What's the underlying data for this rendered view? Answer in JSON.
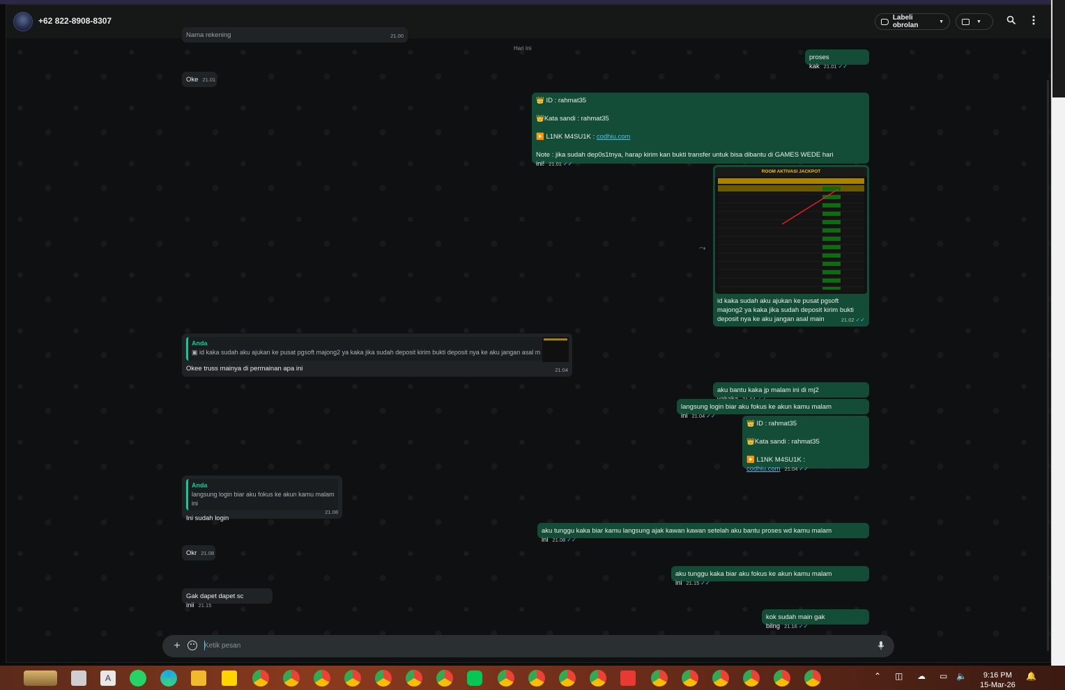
{
  "header": {
    "contact_name": "+62 822-8908-8307",
    "label_button": "Labeli obrolan",
    "video_icon": "video-call-icon",
    "search_icon": "search-icon",
    "menu_icon": "more-vert-icon"
  },
  "chat": {
    "clipped_top_text": "Nama rekening",
    "clipped_top_time": "21.00",
    "day_chip": "Hari Ini",
    "messages": {
      "m1": {
        "text": "proses kak",
        "time": "21.01"
      },
      "m2": {
        "text": "Oke",
        "time": "21.01"
      },
      "m3": {
        "line1": "👑 ID :  rahmat35",
        "line2": "👑Kata sandi : rahmat35",
        "line3_prefix": "▶️ L1NK M4SU1K : ",
        "line3_link": "codhiu.com",
        "line4": "Note : jika sudah dep0s1tnya, harap kirim kan bukti transfer untuk bisa dibantu di GAMES WEDE hari ini!",
        "time": "21.01"
      },
      "m4": {
        "image_title": "ROOM AKTIVASI JACKPOT",
        "caption": "id kaka sudah aku ajukan ke pusat pgsoft majong2 ya kaka jika sudah deposit kirim bukti deposit nya ke aku jangan asal main",
        "time": "21.02"
      },
      "m5": {
        "quote_name": "Anda",
        "quote_text": "id kaka sudah aku ajukan ke pusat pgsoft majong2 ya kaka jika sudah deposit kirim bukti deposit nya ke aku jangan asal main",
        "text": "Okee truss mainya di permainan apa ini",
        "time": "21.04"
      },
      "m6": {
        "text": "aku bantu kaka jp malam ini di mj2 yakaka",
        "time": "21.04"
      },
      "m7": {
        "text": "langsung login biar aku fokus ke akun kamu malam ini",
        "time": "21.04"
      },
      "m8": {
        "line1": "👑 ID :  rahmat35",
        "line2": "👑Kata sandi : rahmat35",
        "line3_prefix": "▶️ L1NK M4SU1K : ",
        "line3_link": "codhiu.com",
        "time": "21.04"
      },
      "m9": {
        "quote_name": "Anda",
        "quote_text": "langsung login biar aku fokus ke akun kamu malam ini",
        "text": "Ini sudah login",
        "time": "21.08"
      },
      "m10": {
        "text": "aku tunggu kaka biar kamu langsung ajak kawan kawan setelah aku bantu proses wd kamu malam ini",
        "time": "21.08"
      },
      "m11": {
        "text": "Okr",
        "time": "21.08"
      },
      "m12": {
        "text": "aku tunggu kaka biar aku fokus ke akun kamu malam ini",
        "time": "21.15"
      },
      "m13": {
        "text": "Gak dapet dapet sc inii",
        "time": "21.15"
      },
      "m14": {
        "text": "kok sudah main gak bilng",
        "time": "21.16"
      }
    }
  },
  "composer": {
    "placeholder": "Ketik pesan",
    "attach_icon": "plus-icon",
    "emoji_icon": "sticker-icon",
    "mic_icon": "mic-icon"
  },
  "taskbar": {
    "time": "9:16 PM",
    "date": "15-Mar-26"
  },
  "colors": {
    "outgoing_bubble": "#144d37",
    "incoming_bubble": "#1f2326",
    "accent": "#06cf9c",
    "read_ticks": "#53bdeb"
  }
}
